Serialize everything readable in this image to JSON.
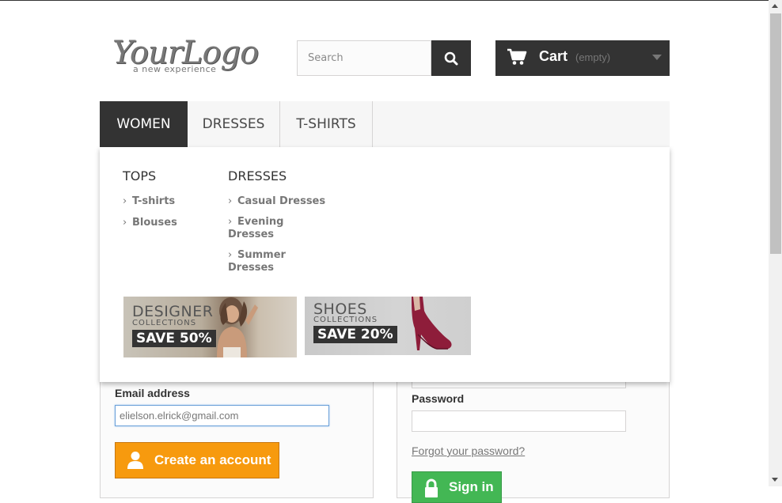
{
  "header": {
    "logo_text": "YourLogo",
    "logo_tagline": "a new experience",
    "search_placeholder": "Search",
    "search_icon": "search-icon",
    "cart": {
      "label": "Cart",
      "status": "(empty)",
      "icon": "shopping-cart-icon"
    }
  },
  "menu": {
    "items": [
      {
        "label": "WOMEN",
        "active": true
      },
      {
        "label": "DRESSES",
        "active": false
      },
      {
        "label": "T-SHIRTS",
        "active": false
      }
    ]
  },
  "dropdown": {
    "columns": [
      {
        "heading": "TOPS",
        "items": [
          "T-shirts",
          "Blouses"
        ]
      },
      {
        "heading": "DRESSES",
        "items": [
          "Casual Dresses",
          "Evening Dresses",
          "Summer Dresses"
        ]
      }
    ],
    "banners": [
      {
        "title": "DESIGNER",
        "subtitle": "COLLECTIONS",
        "promo": "SAVE 50%"
      },
      {
        "title": "SHOES",
        "subtitle": "COLLECTIONS",
        "promo": "SAVE 20%"
      }
    ]
  },
  "create_account": {
    "email_label": "Email address",
    "email_value": "elielson.elrick@gmail.com",
    "button_label": "Create an account",
    "button_icon": "user-icon",
    "accent": "#f79a0e"
  },
  "login": {
    "password_label": "Password",
    "password_value": "",
    "forgot_link": "Forgot your password?",
    "signin_label": "Sign in",
    "signin_icon": "lock-icon",
    "accent": "#43b754"
  }
}
